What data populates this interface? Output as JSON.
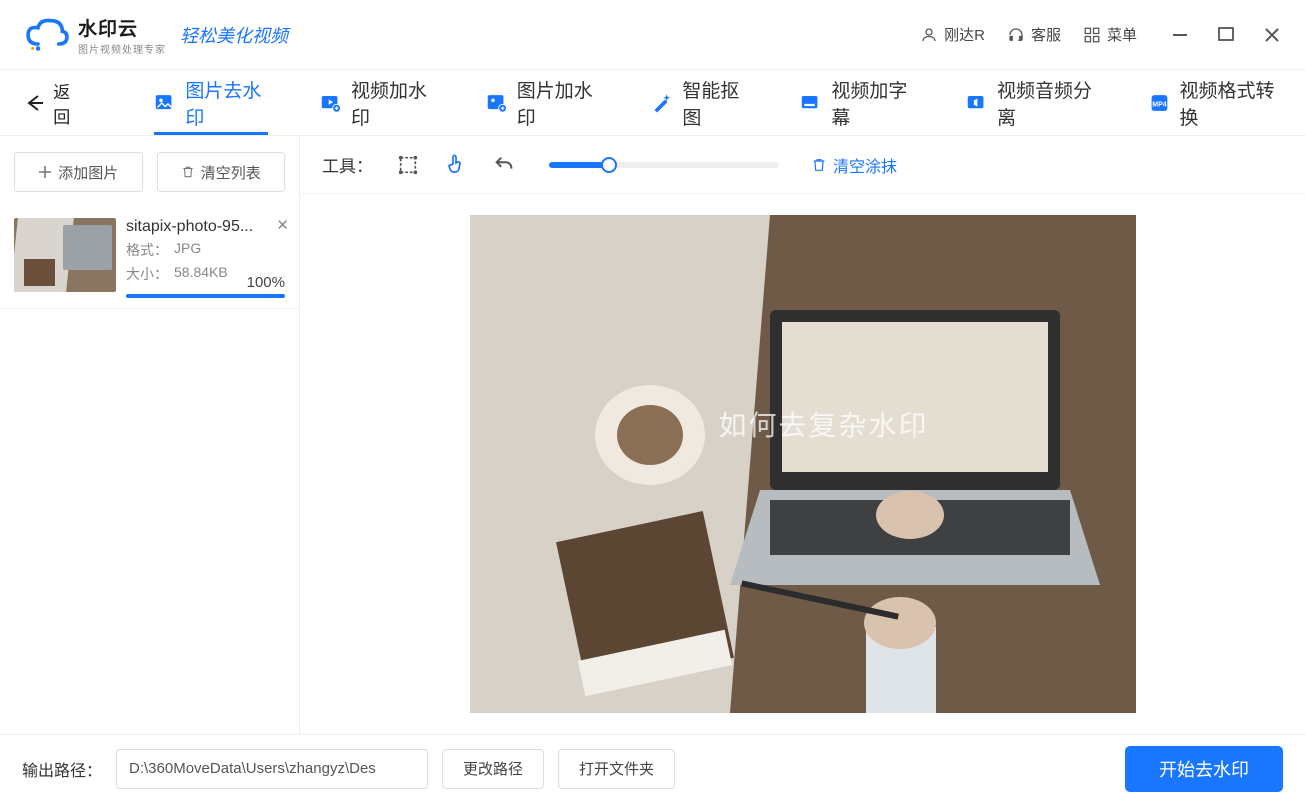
{
  "titlebar": {
    "app_name": "水印云",
    "app_sub": "图片视频处理专家",
    "tagline": "轻松美化视频",
    "user_label": "刚达R",
    "support_label": "客服",
    "menu_label": "菜单"
  },
  "tabs": {
    "back_label": "返回",
    "image_remove_wm": "图片去水印",
    "video_add_wm": "视频加水印",
    "image_add_wm": "图片加水印",
    "smart_cutout": "智能抠图",
    "video_subtitle": "视频加字幕",
    "video_audio_split": "视频音频分离",
    "video_convert": "视频格式转换"
  },
  "sidebar": {
    "add_btn": "添加图片",
    "clear_btn": "清空列表",
    "file": {
      "name": "sitapix-photo-95...",
      "fmt_label": "格式：",
      "fmt_value": "JPG",
      "size_label": "大小：",
      "size_value": "58.84KB",
      "progress_pct": "100%"
    }
  },
  "toolbar": {
    "label": "工具：",
    "clear_smear": "清空涂抹"
  },
  "canvas": {
    "watermark_text": "如何去复杂水印"
  },
  "footer": {
    "out_label": "输出路径：",
    "out_path": "D:\\360MoveData\\Users\\zhangyz\\Des",
    "change_path": "更改路径",
    "open_folder": "打开文件夹",
    "start_btn": "开始去水印"
  }
}
